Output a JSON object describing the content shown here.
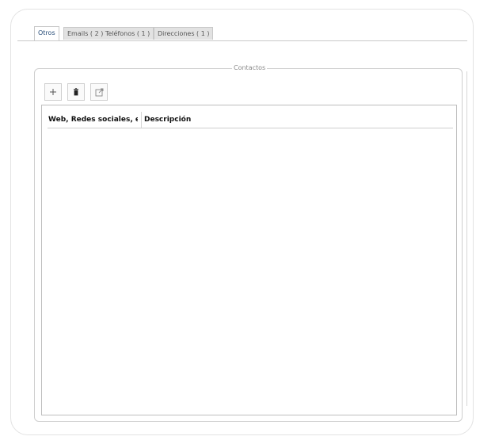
{
  "tabs": [
    {
      "label": "Otros",
      "active": true
    },
    {
      "label": "Emails ( 2 ) Teléfonos ( 1 )",
      "active": false
    },
    {
      "label": "Direcciones ( 1 )",
      "active": false
    }
  ],
  "contacts": {
    "legend": "Contactos",
    "toolbar": {
      "add_icon": "plus-icon",
      "delete_icon": "trash-icon",
      "open_icon": "external-link-icon"
    },
    "columns": [
      {
        "label": "Web, Redes sociales, etc..."
      },
      {
        "label": "Descripción"
      }
    ],
    "rows": []
  },
  "colors": {
    "active_tab_text": "#2a4f7a",
    "inactive_tab_bg": "#e2e2e2",
    "border": "#cfcfcf"
  }
}
